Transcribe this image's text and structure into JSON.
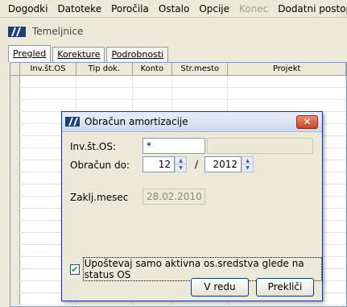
{
  "menu": [
    "Dogodki",
    "Datoteke",
    "Poročila",
    "Ostalo",
    "Opcije",
    "Konec",
    "Dodatni postopki"
  ],
  "menu_disabled_index": 5,
  "window": {
    "title": "Temeljnice"
  },
  "tabs": [
    {
      "label": "Pregled",
      "active": true
    },
    {
      "label": "Korekture",
      "active": false
    },
    {
      "label": "Podrobnosti",
      "active": false
    }
  ],
  "grid": {
    "columns": [
      "Inv.št.OS",
      "Tip dok.",
      "Konto",
      "Str.mesto",
      "Projekt"
    ]
  },
  "dialog": {
    "title": "Obračun amortizacije",
    "close_glyph": "✕",
    "inv_label": "Inv.št.OS:",
    "inv_value": "*",
    "inv_desc": "",
    "obracun_label": "Obračun do:",
    "month": "12",
    "separator": "/",
    "year": "2012",
    "zakl_label": "Zaklj.mesec",
    "zakl_value": "28.02.2010",
    "checkbox_label": "Upoštevaj samo aktivna os.sredstva glede na status OS",
    "checkbox_checked": true,
    "ok_label": "V redu",
    "cancel_label": "Prekliči"
  },
  "colors": {
    "title_border": "#0831d9",
    "close": "#c8452a",
    "accent": "#7f9db9"
  }
}
